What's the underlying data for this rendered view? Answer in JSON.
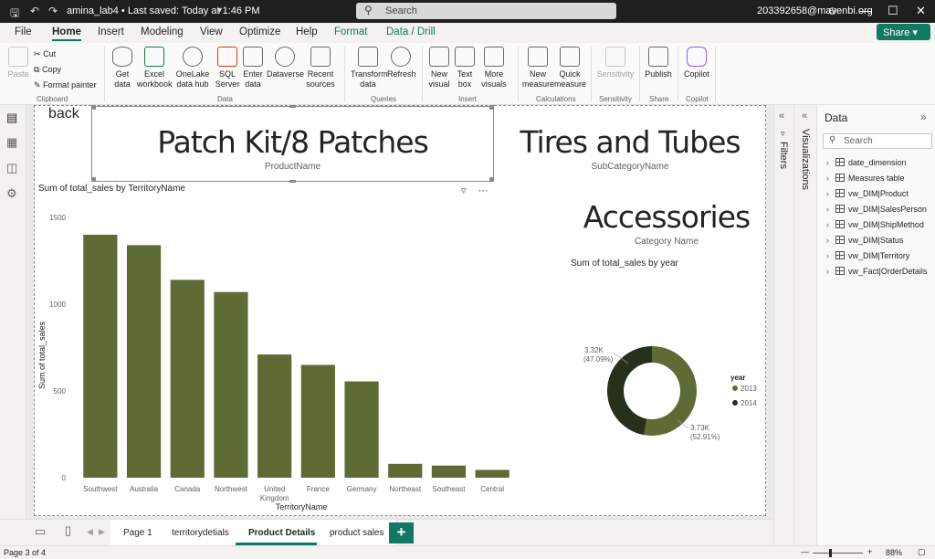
{
  "titlebar": {
    "file_title": "amina_lab4 • Last saved: Today at 1:46 PM",
    "search_placeholder": "Search",
    "account": "203392658@mavenbi.org"
  },
  "menu": {
    "tabs": [
      "File",
      "Home",
      "Insert",
      "Modeling",
      "View",
      "Optimize",
      "Help",
      "Format",
      "Data / Drill"
    ],
    "active": "Home",
    "share_label": "Share"
  },
  "ribbon": {
    "clipboard": {
      "paste": "Paste",
      "cut": "Cut",
      "copy": "Copy",
      "format_painter": "Format painter",
      "group": "Clipboard"
    },
    "data": {
      "get_data": "Get data",
      "excel": "Excel workbook",
      "onelake": "OneLake data hub",
      "sql": "SQL Server",
      "enter": "Enter data",
      "dataverse": "Dataverse",
      "recent": "Recent sources",
      "group": "Data"
    },
    "queries": {
      "transform": "Transform data",
      "refresh": "Refresh",
      "group": "Queries"
    },
    "insert": {
      "new_visual": "New visual",
      "text_box": "Text box",
      "more_visuals": "More visuals",
      "group": "Insert"
    },
    "calculations": {
      "new_measure": "New measure",
      "quick_measure": "Quick measure",
      "group": "Calculations"
    },
    "sensitivity": {
      "label": "Sensitivity",
      "group": "Sensitivity"
    },
    "share": {
      "publish": "Publish",
      "group": "Share"
    },
    "copilot": {
      "label": "Copilot",
      "group": "Copilot"
    }
  },
  "canvas": {
    "back_label": "back",
    "card_product": {
      "value": "Patch Kit/8 Patches",
      "label": "ProductName"
    },
    "card_subcategory": {
      "value": "Tires and Tubes",
      "label": "SubCategoryName"
    },
    "card_category": {
      "value": "Accessories",
      "label": "Category Name"
    }
  },
  "chart_data": [
    {
      "type": "bar",
      "title": "Sum of total_sales by TerritoryName",
      "xlabel": "TerritoryName",
      "ylabel": "Sum of total_sales",
      "categories": [
        "Southwest",
        "Australia",
        "Canada",
        "Northwest",
        "United Kingdom",
        "France",
        "Germany",
        "Northeast",
        "Southeast",
        "Central"
      ],
      "values": [
        1400,
        1340,
        1140,
        1070,
        710,
        650,
        555,
        80,
        70,
        45
      ],
      "yticks": [
        "0",
        "500",
        "1000",
        "1500"
      ],
      "ylim": [
        0,
        1500
      ],
      "color": "#5f6b35"
    },
    {
      "type": "pie",
      "title": "Sum of total_sales by year",
      "legend_title": "year",
      "slices": [
        {
          "name": "2013",
          "value": 3.73,
          "label": "3.73K",
          "pct": "(52.91%)",
          "color": "#5f6b35"
        },
        {
          "name": "2014",
          "value": 3.32,
          "label": "3.32K",
          "pct": "(47.09%)",
          "color": "#27301a"
        }
      ]
    }
  ],
  "panes": {
    "filters": "Filters",
    "visualizations": "Visualizations",
    "data_title": "Data",
    "data_search": "Search",
    "tables": [
      "date_dimension",
      "Measures table",
      "vw_DIM|Product",
      "vw_DIM|SalesPerson",
      "vw_DIM|ShipMethod",
      "vw_DIM|Status",
      "vw_DIM|Territory",
      "vw_Fact|OrderDetails"
    ]
  },
  "pages": {
    "tabs": [
      "Page 1",
      "territorydetials",
      "Product Details",
      "product sales"
    ],
    "active": "Product Details"
  },
  "status": {
    "page_info": "Page 3 of 4",
    "zoom": "88%"
  }
}
